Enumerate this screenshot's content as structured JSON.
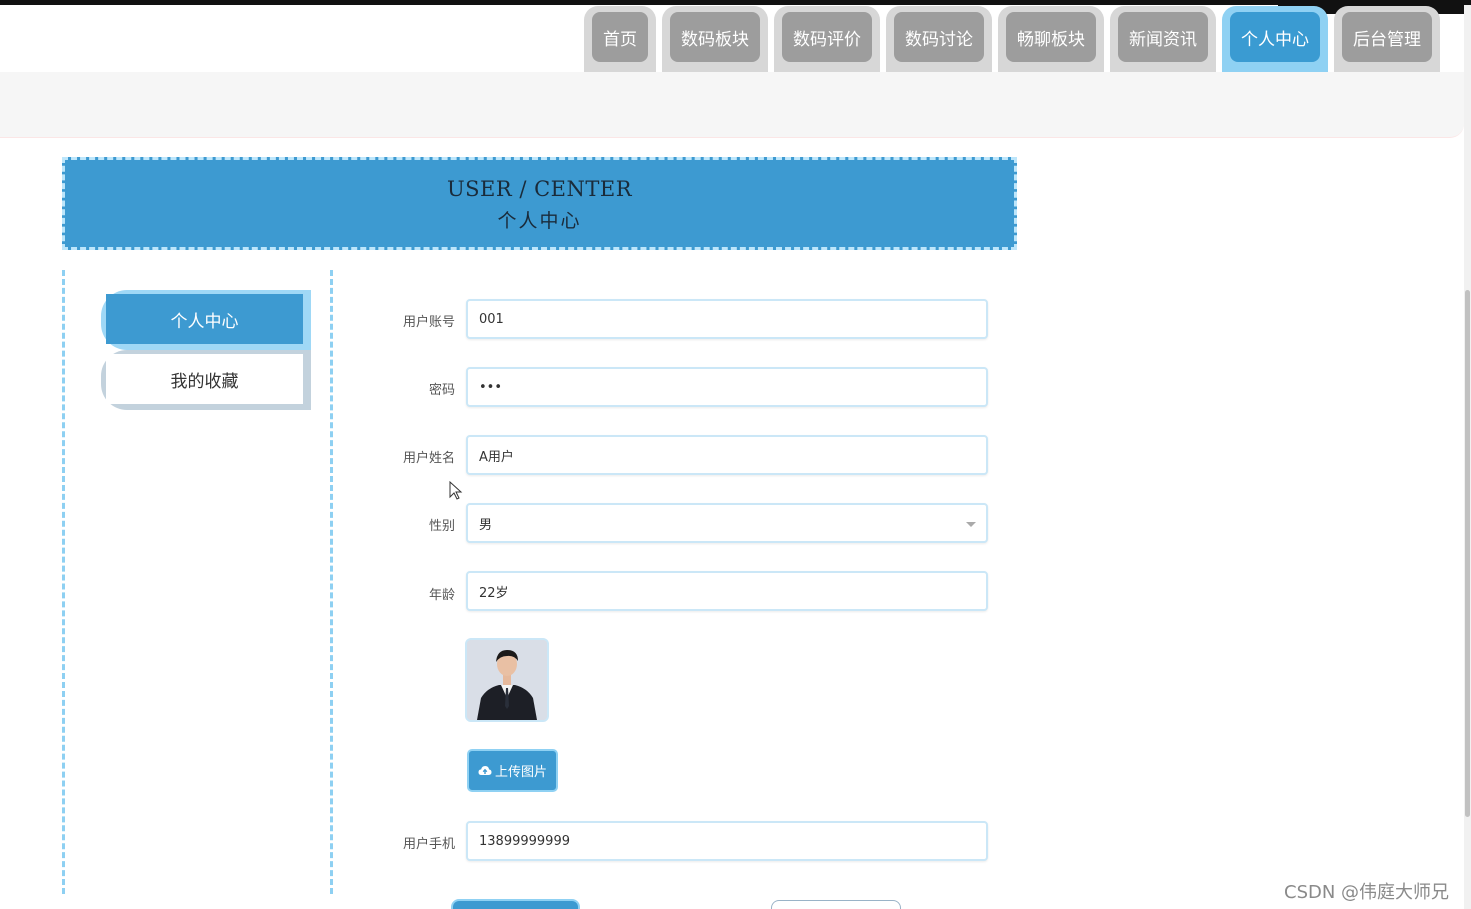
{
  "nav": {
    "tabs": [
      "首页",
      "数码板块",
      "数码评价",
      "数码讨论",
      "畅聊板块",
      "新闻资讯",
      "个人中心",
      "后台管理"
    ],
    "active_index": 6
  },
  "banner": {
    "title_en": "USER / CENTER",
    "title_cn": "个人中心"
  },
  "sidebar": {
    "items": [
      {
        "label": "个人中心",
        "active": true
      },
      {
        "label": "我的收藏",
        "active": false
      }
    ]
  },
  "form": {
    "account": {
      "label": "用户账号",
      "value": "001"
    },
    "password": {
      "label": "密码",
      "value": "•••"
    },
    "name": {
      "label": "用户姓名",
      "value": "A用户"
    },
    "gender": {
      "label": "性别",
      "value": "男"
    },
    "age": {
      "label": "年龄",
      "value": "22岁"
    },
    "upload_label": "上传图片",
    "phone": {
      "label": "用户手机",
      "value": "13899999999"
    }
  },
  "watermark": "CSDN @伟庭大师兄",
  "colors": {
    "accent": "#3d9ad1",
    "accent_light": "#8fd1f3",
    "tab_gray": "#9d9d9d"
  }
}
